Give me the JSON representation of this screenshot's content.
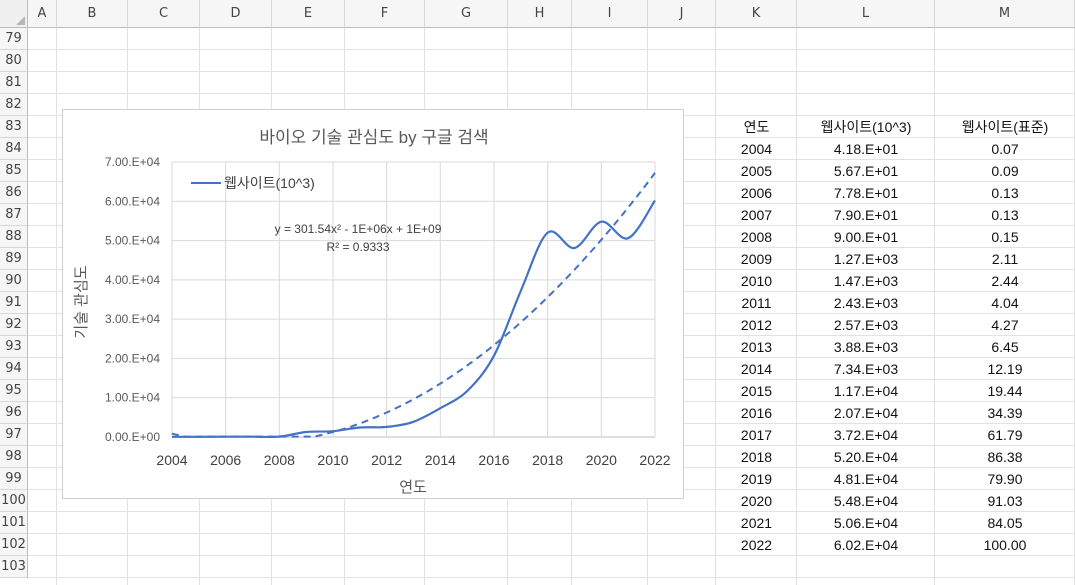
{
  "columns": [
    "A",
    "B",
    "C",
    "D",
    "E",
    "F",
    "G",
    "H",
    "I",
    "J",
    "K",
    "L",
    "M"
  ],
  "rows": [
    "79",
    "80",
    "81",
    "82",
    "83",
    "84",
    "85",
    "86",
    "87",
    "88",
    "89",
    "90",
    "91",
    "92",
    "93",
    "94",
    "95",
    "96",
    "97",
    "98",
    "99",
    "100",
    "101",
    "102",
    "103"
  ],
  "table": {
    "headers": [
      "연도",
      "웹사이트(10^3)",
      "웹사이트(표준)"
    ],
    "rows": [
      [
        "2004",
        "4.18.E+01",
        "0.07"
      ],
      [
        "2005",
        "5.67.E+01",
        "0.09"
      ],
      [
        "2006",
        "7.78.E+01",
        "0.13"
      ],
      [
        "2007",
        "7.90.E+01",
        "0.13"
      ],
      [
        "2008",
        "9.00.E+01",
        "0.15"
      ],
      [
        "2009",
        "1.27.E+03",
        "2.11"
      ],
      [
        "2010",
        "1.47.E+03",
        "2.44"
      ],
      [
        "2011",
        "2.43.E+03",
        "4.04"
      ],
      [
        "2012",
        "2.57.E+03",
        "4.27"
      ],
      [
        "2013",
        "3.88.E+03",
        "6.45"
      ],
      [
        "2014",
        "7.34.E+03",
        "12.19"
      ],
      [
        "2015",
        "1.17.E+04",
        "19.44"
      ],
      [
        "2016",
        "2.07.E+04",
        "34.39"
      ],
      [
        "2017",
        "3.72.E+04",
        "61.79"
      ],
      [
        "2018",
        "5.20.E+04",
        "86.38"
      ],
      [
        "2019",
        "4.81.E+04",
        "79.90"
      ],
      [
        "2020",
        "5.48.E+04",
        "91.03"
      ],
      [
        "2021",
        "5.06.E+04",
        "84.05"
      ],
      [
        "2022",
        "6.02.E+04",
        "100.00"
      ]
    ]
  },
  "chart_data": {
    "type": "line",
    "title": "바이오 기술 관심도 by 구글 검색",
    "xlabel": "연도",
    "ylabel": "기술 관심도",
    "x": [
      2004,
      2005,
      2006,
      2007,
      2008,
      2009,
      2010,
      2011,
      2012,
      2013,
      2014,
      2015,
      2016,
      2017,
      2018,
      2019,
      2020,
      2021,
      2022
    ],
    "series": [
      {
        "name": "웹사이트(10^3)",
        "values": [
          41.8,
          56.7,
          77.8,
          79.0,
          90.0,
          1270,
          1470,
          2430,
          2570,
          3880,
          7340,
          11700,
          20700,
          37200,
          52000,
          48100,
          54800,
          50600,
          60200
        ],
        "color": "#4472C4",
        "smooth": true
      }
    ],
    "trendline": {
      "type": "polynomial",
      "order": 2,
      "equation": "y = 301.54x² - 1E+06x + 1E+09",
      "r2": "R² = 0.9333",
      "style": "dashed",
      "color": "#4472C4"
    },
    "xlim": [
      2004,
      2022
    ],
    "ylim": [
      0,
      70000
    ],
    "xticks": [
      "2004",
      "2006",
      "2008",
      "2010",
      "2012",
      "2014",
      "2016",
      "2018",
      "2020",
      "2022"
    ],
    "yticks": [
      "0.00.E+00",
      "1.00.E+04",
      "2.00.E+04",
      "3.00.E+04",
      "4.00.E+04",
      "5.00.E+04",
      "6.00.E+04",
      "7.00.E+04"
    ],
    "legend_position": "top-left",
    "grid": true
  }
}
